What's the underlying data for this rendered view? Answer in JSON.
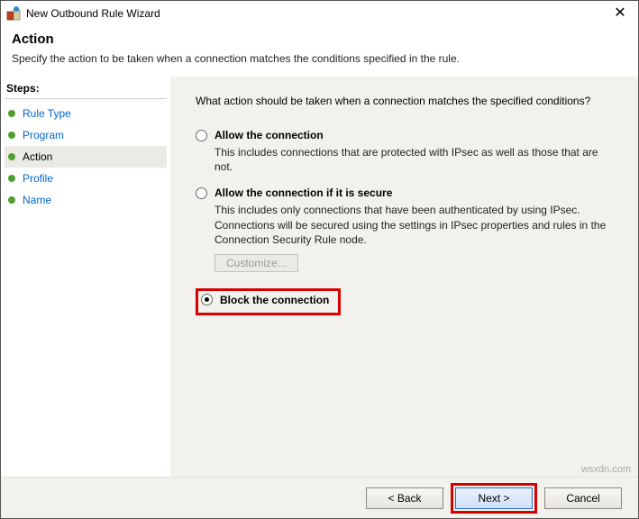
{
  "window": {
    "title": "New Outbound Rule Wizard"
  },
  "header": {
    "title": "Action",
    "subtitle": "Specify the action to be taken when a connection matches the conditions specified in the rule."
  },
  "sidebar": {
    "label": "Steps:",
    "items": [
      {
        "label": "Rule Type",
        "current": false
      },
      {
        "label": "Program",
        "current": false
      },
      {
        "label": "Action",
        "current": true
      },
      {
        "label": "Profile",
        "current": false
      },
      {
        "label": "Name",
        "current": false
      }
    ]
  },
  "content": {
    "prompt": "What action should be taken when a connection matches the specified conditions?",
    "options": {
      "allow": {
        "label": "Allow the connection",
        "desc": "This includes connections that are protected with IPsec as well as those that are not."
      },
      "allow_secure": {
        "label": "Allow the connection if it is secure",
        "desc": "This includes only connections that have been authenticated by using IPsec. Connections will be secured using the settings in IPsec properties and rules in the Connection Security Rule node.",
        "customize": "Customize..."
      },
      "block": {
        "label": "Block the connection"
      }
    }
  },
  "footer": {
    "back": "< Back",
    "next": "Next >",
    "cancel": "Cancel"
  },
  "watermark": "wsxdn.com"
}
